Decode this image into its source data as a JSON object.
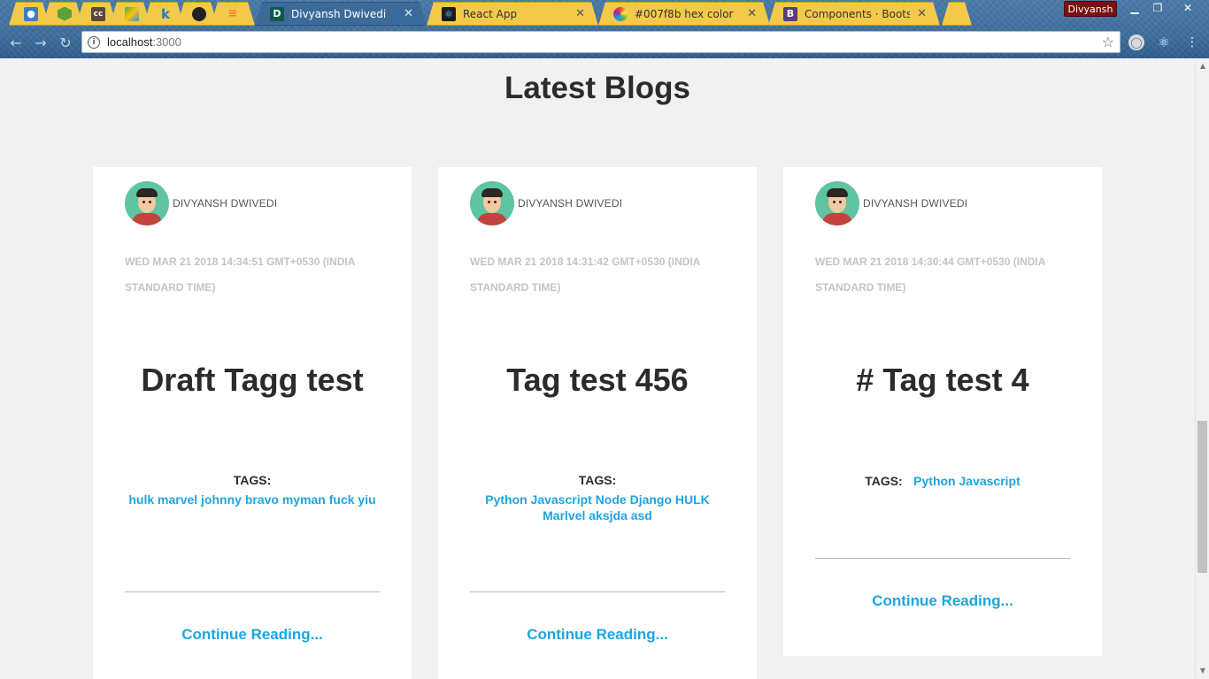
{
  "browser": {
    "tabs": [
      {
        "title": "",
        "favicon": "bird-icon",
        "active": false
      },
      {
        "title": "",
        "favicon": "nodejs-icon",
        "active": false
      },
      {
        "title": "",
        "favicon": "cc-icon",
        "active": false
      },
      {
        "title": "",
        "favicon": "maps-icon",
        "active": false
      },
      {
        "title": "",
        "favicon": "k-icon",
        "active": false
      },
      {
        "title": "",
        "favicon": "github-icon",
        "active": false
      },
      {
        "title": "",
        "favicon": "stackoverflow-icon",
        "active": false
      },
      {
        "title": "Divyansh Dwivedi",
        "favicon": "d-icon",
        "active": true
      },
      {
        "title": "React App",
        "favicon": "react-icon",
        "active": false
      },
      {
        "title": "#007f8b hex color",
        "favicon": "colorhexa-icon",
        "active": false
      },
      {
        "title": "Components · Bootstrap",
        "favicon": "bootstrap-icon",
        "active": false
      }
    ],
    "profile_name": "Divyansh",
    "url_host": "localhost",
    "url_port": ":3000"
  },
  "page": {
    "heading": "Latest Blogs",
    "continue_label": "Continue Reading...",
    "tags_label": "TAGS:"
  },
  "posts": [
    {
      "author": "DIVYANSH DWIVEDI",
      "date": "WED MAR 21 2018 14:34:51 GMT+0530 (INDIA STANDARD TIME)",
      "title": "Draft Tagg test",
      "tags": "hulk marvel johnny bravo myman fuck yiu"
    },
    {
      "author": "DIVYANSH DWIVEDI",
      "date": "WED MAR 21 2018 14:31:42 GMT+0530 (INDIA STANDARD TIME)",
      "title": "Tag test 456",
      "tags": "Python Javascript Node Django HULK Marlvel aksjda asd"
    },
    {
      "author": "DIVYANSH DWIVEDI",
      "date": "WED MAR 21 2018 14:30:44 GMT+0530 (INDIA STANDARD TIME)",
      "title": "# Tag test 4",
      "tags": "Python Javascript"
    }
  ]
}
